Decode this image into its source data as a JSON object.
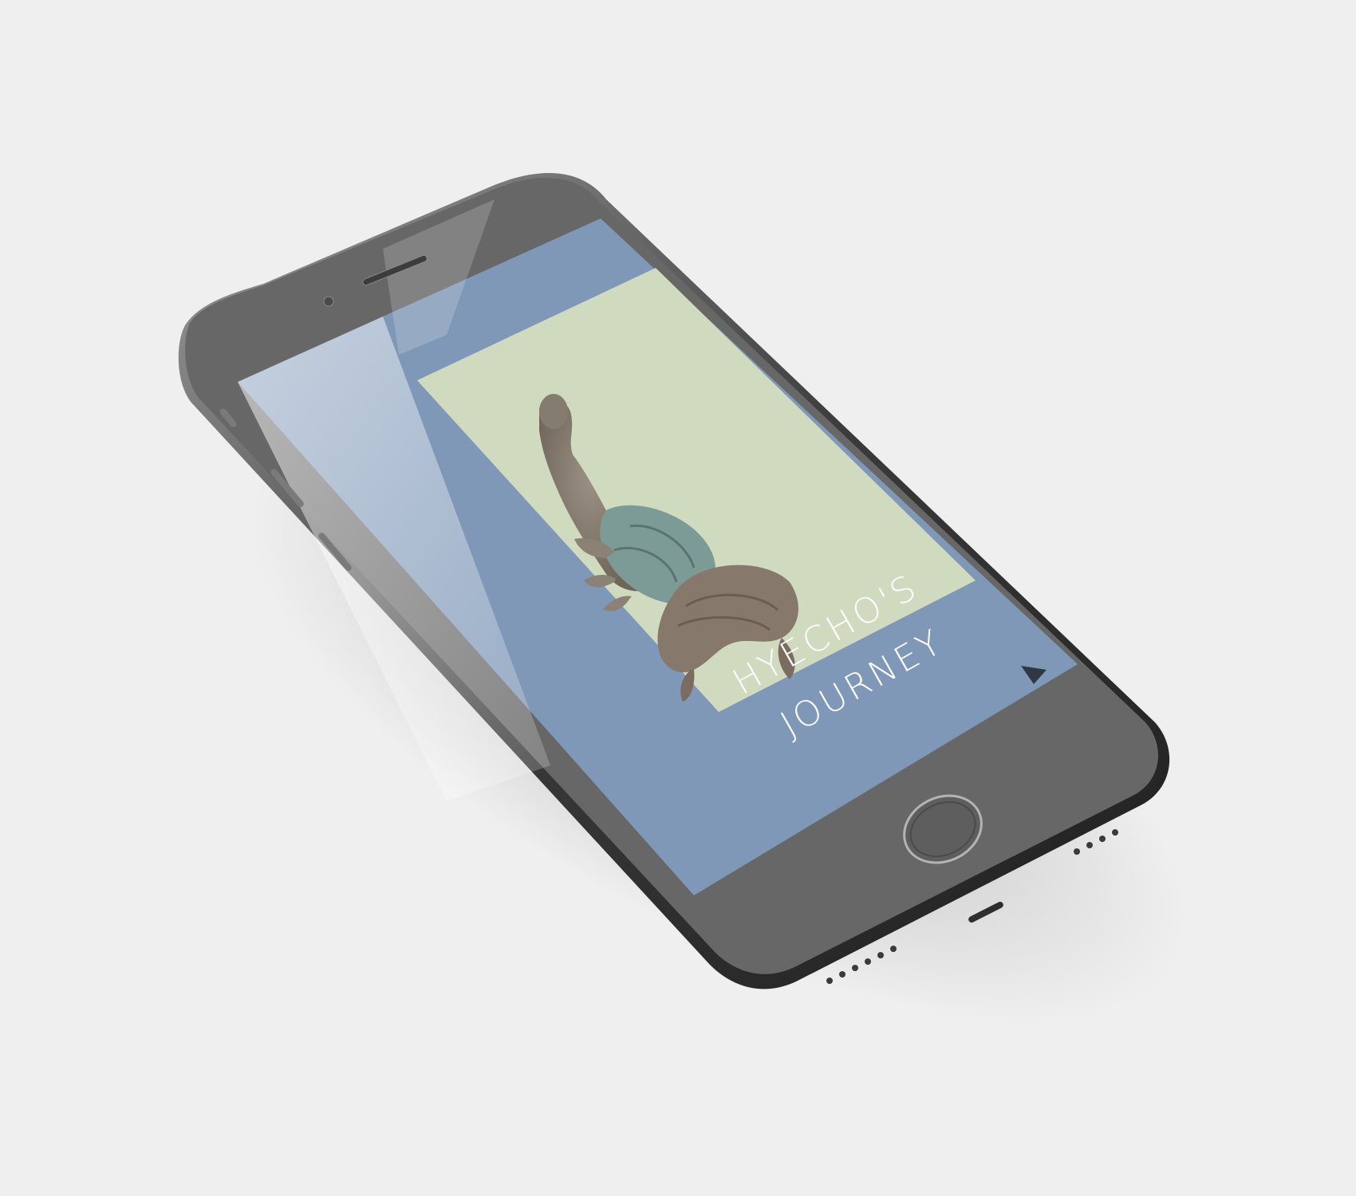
{
  "app": {
    "title_line1": "HYECHO'S",
    "title_line2": "JOURNEY"
  },
  "screen": {
    "background_color": "#7f98b8",
    "panel_color": "#cfdabf",
    "text_color": "#ffffff"
  },
  "device": {
    "body_color": "#676767",
    "frame_color": "#2c2c2c",
    "background": "#efefef"
  },
  "icons": {
    "next": "play-triangle-icon",
    "statue": "buddha-statue-image",
    "home": "home-button-icon",
    "speaker": "earpiece-speaker-icon",
    "camera": "front-camera-icon"
  }
}
